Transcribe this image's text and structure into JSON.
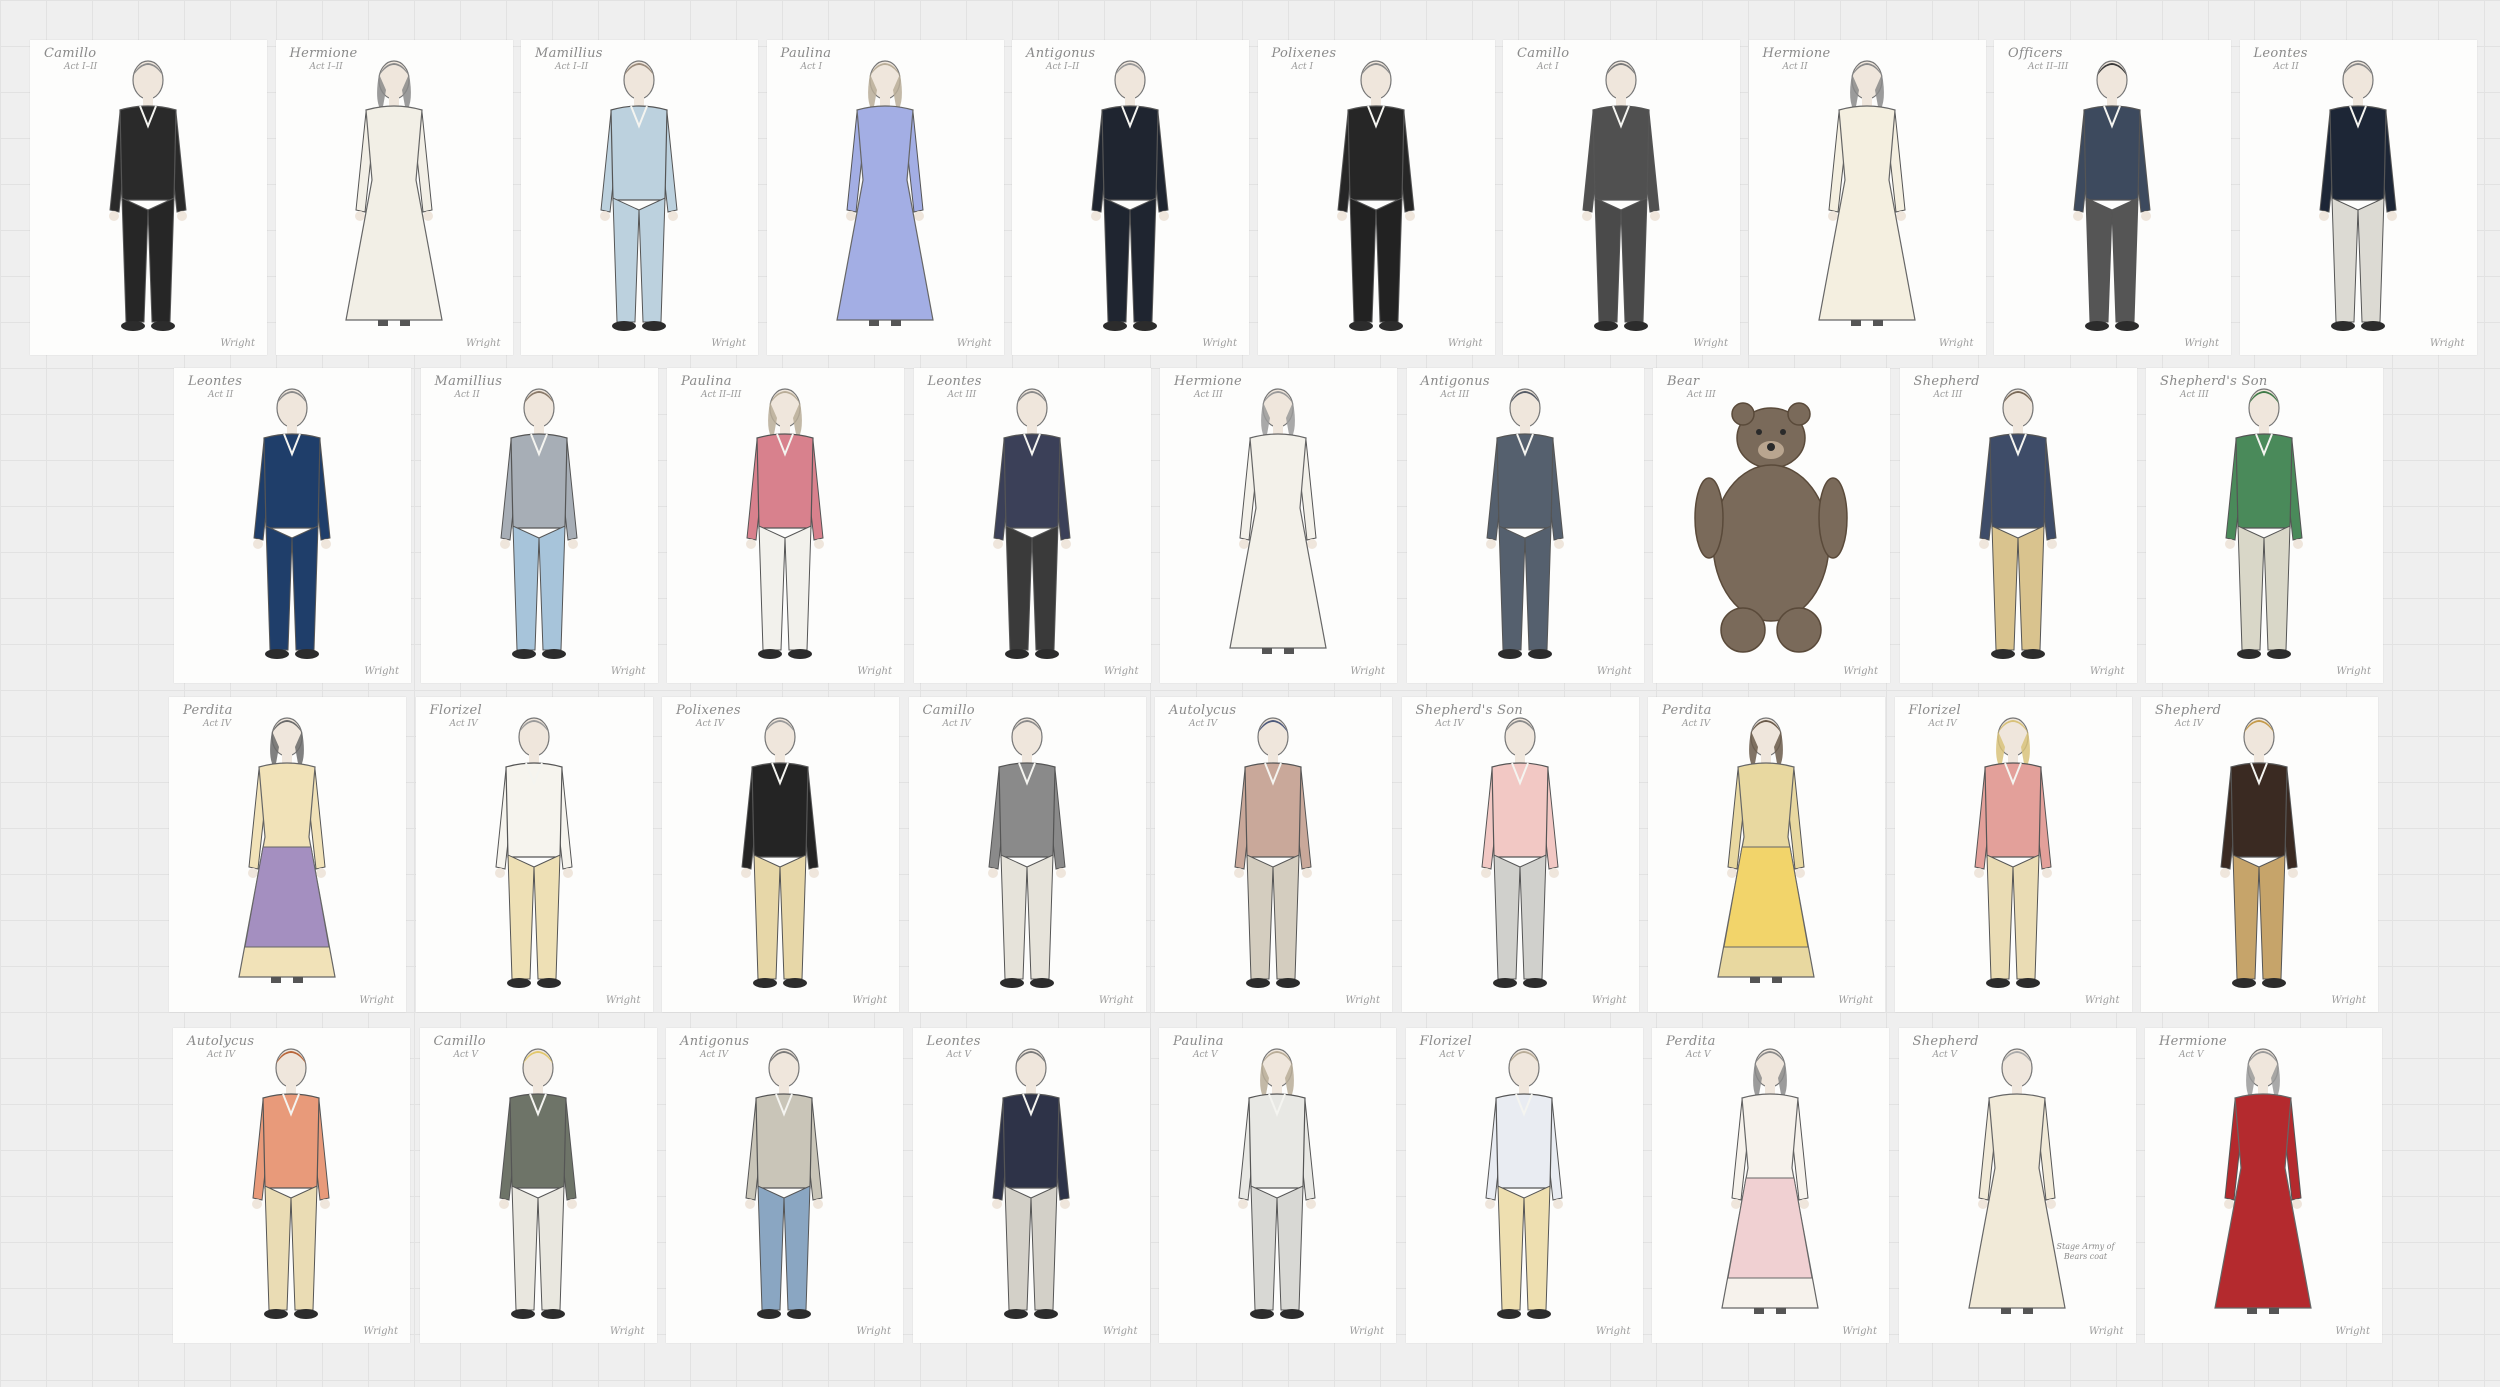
{
  "board": {
    "cards": [
      {
        "character": "Camillo",
        "act": "Act I–II",
        "sig": "Wright",
        "figure": "man",
        "top": "#2a2a2a",
        "bottom": "#262626",
        "skin": "#efe6dc",
        "hair": "#8c8c8c",
        "dress": false
      },
      {
        "character": "Hermione",
        "act": "Act I–II",
        "sig": "Wright",
        "figure": "woman",
        "top": "#f2efe6",
        "bottom": "#f2efe6",
        "skin": "#efe6dc",
        "hair": "#8a8a8a",
        "dress": true
      },
      {
        "character": "Mamillius",
        "act": "Act I–II",
        "sig": "Wright",
        "figure": "man",
        "top": "#bcd1de",
        "bottom": "#bcd1de",
        "skin": "#efe6dc",
        "hair": "#9a8a7a",
        "dress": false
      },
      {
        "character": "Paulina",
        "act": "Act I",
        "sig": "Wright",
        "figure": "woman",
        "top": "#a3aee4",
        "bottom": "#a3aee4",
        "skin": "#efe6dc",
        "hair": "#b9ad98",
        "dress": true
      },
      {
        "character": "Antigonus",
        "act": "Act I–II",
        "sig": "Wright",
        "figure": "man",
        "top": "#1f2530",
        "bottom": "#1f2530",
        "skin": "#efe6dc",
        "hair": "#999999",
        "dress": false
      },
      {
        "character": "Polixenes",
        "act": "Act I",
        "sig": "Wright",
        "figure": "man",
        "top": "#262626",
        "bottom": "#222222",
        "skin": "#efe6dc",
        "hair": "#8a8a8a",
        "dress": false
      },
      {
        "character": "Camillo",
        "act": "Act I",
        "sig": "Wright",
        "figure": "man",
        "top": "#505050",
        "bottom": "#4a4a4a",
        "skin": "#efe6dc",
        "hair": "#7a7a7a",
        "dress": false
      },
      {
        "character": "Hermione",
        "act": "Act II",
        "sig": "Wright",
        "figure": "woman",
        "top": "#f4efe0",
        "bottom": "#f4efe0",
        "skin": "#efe6dc",
        "hair": "#8a8a8a",
        "dress": true
      },
      {
        "character": "Officers",
        "act": "Act II–III",
        "sig": "Wright",
        "figure": "man",
        "top": "#3d4a5e",
        "bottom": "#555555",
        "skin": "#efe6dc",
        "hair": "#3a3a3a",
        "dress": false
      },
      {
        "character": "Leontes",
        "act": "Act II",
        "sig": "Wright",
        "figure": "man",
        "top": "#1d2636",
        "bottom": "#dcdad3",
        "skin": "#efe6dc",
        "hair": "#8a8a8a",
        "dress": false
      },
      {
        "character": "Leontes",
        "act": "Act II",
        "sig": "Wright",
        "figure": "man",
        "top": "#1f3e6a",
        "bottom": "#1f3e6a",
        "skin": "#efe6dc",
        "hair": "#8a8a8a",
        "dress": false
      },
      {
        "character": "Mamillius",
        "act": "Act II",
        "sig": "Wright",
        "figure": "man",
        "top": "#a7aeb6",
        "bottom": "#a7c4da",
        "skin": "#efe6dc",
        "hair": "#8a7a6a",
        "dress": false
      },
      {
        "character": "Paulina",
        "act": "Act II–III",
        "sig": "Wright",
        "figure": "woman",
        "top": "#d8818d",
        "bottom": "#f2f1ec",
        "skin": "#efe6dc",
        "hair": "#b9ad98",
        "dress": false
      },
      {
        "character": "Leontes",
        "act": "Act III",
        "sig": "Wright",
        "figure": "man",
        "top": "#3b4058",
        "bottom": "#3a3a3a",
        "skin": "#efe6dc",
        "hair": "#8a8a8a",
        "dress": false
      },
      {
        "character": "Hermione",
        "act": "Act III",
        "sig": "Wright",
        "figure": "woman",
        "top": "#f3f1ea",
        "bottom": "#f3f1ea",
        "skin": "#efe6dc",
        "hair": "#9a9a9a",
        "dress": true
      },
      {
        "character": "Antigonus",
        "act": "Act III",
        "sig": "Wright",
        "figure": "man",
        "top": "#55606e",
        "bottom": "#55606e",
        "skin": "#efe6dc",
        "hair": "#555b66",
        "dress": false
      },
      {
        "character": "Bear",
        "act": "Act III",
        "sig": "Wright",
        "figure": "bear",
        "top": "#7a6a5a",
        "bottom": "#7a6a5a",
        "skin": "#8a7a6a",
        "hair": "#6a5a4a",
        "dress": false
      },
      {
        "character": "Shepherd",
        "act": "Act III",
        "sig": "Wright",
        "figure": "man",
        "top": "#3e4c68",
        "bottom": "#d9c38e",
        "skin": "#efe6dc",
        "hair": "#7a6a58",
        "dress": false
      },
      {
        "character": "Shepherd's Son",
        "act": "Act III",
        "sig": "Wright",
        "figure": "man",
        "top": "#4a8a5a",
        "bottom": "#d9d7c8",
        "skin": "#efe6dc",
        "hair": "#3f7a48",
        "dress": false
      },
      {
        "character": "Perdita",
        "act": "Act IV",
        "sig": "Wright",
        "figure": "woman",
        "top": "#f1e2b8",
        "bottom": "#a48fc0",
        "skin": "#efe6dc",
        "hair": "#6a6a6a",
        "dress": true
      },
      {
        "character": "Florizel",
        "act": "Act IV",
        "sig": "Wright",
        "figure": "man",
        "top": "#f6f4ee",
        "bottom": "#eee0b5",
        "skin": "#efe6dc",
        "hair": "#9a9a9a",
        "dress": false
      },
      {
        "character": "Polixenes",
        "act": "Act IV",
        "sig": "Wright",
        "figure": "man",
        "top": "#242424",
        "bottom": "#e7d7a8",
        "skin": "#efe6dc",
        "hair": "#9a9a9a",
        "dress": false
      },
      {
        "character": "Camillo",
        "act": "Act IV",
        "sig": "Wright",
        "figure": "man",
        "top": "#8a8a8a",
        "bottom": "#e6e3da",
        "skin": "#efe6dc",
        "hair": "#8a8a8a",
        "dress": false
      },
      {
        "character": "Autolycus",
        "act": "Act IV",
        "sig": "Wright",
        "figure": "man",
        "top": "#c9a89a",
        "bottom": "#d4cdbf",
        "skin": "#efe6dc",
        "hair": "#4d5a7c",
        "dress": false
      },
      {
        "character": "Shepherd's Son",
        "act": "Act IV",
        "sig": "Wright",
        "figure": "man",
        "top": "#f2c8c4",
        "bottom": "#d0d0cc",
        "skin": "#efe6dc",
        "hair": "#8a8a8a",
        "dress": false
      },
      {
        "character": "Perdita",
        "act": "Act IV",
        "sig": "Wright",
        "figure": "woman",
        "top": "#e8d8a0",
        "bottom": "#f2d46a",
        "skin": "#efe6dc",
        "hair": "#6a5a4a",
        "dress": true
      },
      {
        "character": "Florizel",
        "act": "Act IV",
        "sig": "Wright",
        "figure": "woman",
        "top": "#e3a09a",
        "bottom": "#eadcb4",
        "skin": "#efe6dc",
        "hair": "#d8c27a",
        "dress": false
      },
      {
        "character": "Shepherd",
        "act": "Act IV",
        "sig": "Wright",
        "figure": "man",
        "top": "#3a2a22",
        "bottom": "#c6a46a",
        "skin": "#efe6dc",
        "hair": "#c49a4a",
        "dress": false
      },
      {
        "character": "Autolycus",
        "act": "Act IV",
        "sig": "Wright",
        "figure": "man",
        "top": "#e89a7a",
        "bottom": "#eadcb4",
        "skin": "#efe6dc",
        "hair": "#b9663a",
        "dress": false
      },
      {
        "character": "Camillo",
        "act": "Act V",
        "sig": "Wright",
        "figure": "man",
        "top": "#6e7468",
        "bottom": "#e9e7df",
        "skin": "#efe6dc",
        "hair": "#e2c86a",
        "dress": false
      },
      {
        "character": "Antigonus",
        "act": "Act IV",
        "sig": "Wright",
        "figure": "man",
        "top": "#c9c5b8",
        "bottom": "#8aa6c2",
        "skin": "#efe6dc",
        "hair": "#7a7a7a",
        "dress": false
      },
      {
        "character": "Leontes",
        "act": "Act V",
        "sig": "Wright",
        "figure": "man",
        "top": "#2e3348",
        "bottom": "#d3d0c8",
        "skin": "#efe6dc",
        "hair": "#7a7a7a",
        "dress": false
      },
      {
        "character": "Paulina",
        "act": "Act V",
        "sig": "Wright",
        "figure": "woman",
        "top": "#e8e8e4",
        "bottom": "#d8d8d4",
        "skin": "#efe6dc",
        "hair": "#b9ad98",
        "dress": false
      },
      {
        "character": "Florizel",
        "act": "Act V",
        "sig": "Wright",
        "figure": "man",
        "top": "#e9ecf2",
        "bottom": "#eedfb0",
        "skin": "#efe6dc",
        "hair": "#b9ad98",
        "dress": false
      },
      {
        "character": "Perdita",
        "act": "Act V",
        "sig": "Wright",
        "figure": "woman",
        "top": "#f6f2ec",
        "bottom": "#f0d0d2",
        "skin": "#efe6dc",
        "hair": "#8a8a8a",
        "dress": true
      },
      {
        "character": "Shepherd",
        "act": "Act V",
        "sig": "Wright",
        "figure": "man",
        "top": "#f1ead8",
        "bottom": "#f1ead8",
        "skin": "#efe6dc",
        "hair": "#aaaaaa",
        "dress": true,
        "note": "Stage Army of Bears coat"
      },
      {
        "character": "Hermione",
        "act": "Act V",
        "sig": "Wright",
        "figure": "woman",
        "top": "#b42a2e",
        "bottom": "#b42a2e",
        "skin": "#efe6dc",
        "hair": "#9a9a9a",
        "dress": true
      }
    ]
  }
}
